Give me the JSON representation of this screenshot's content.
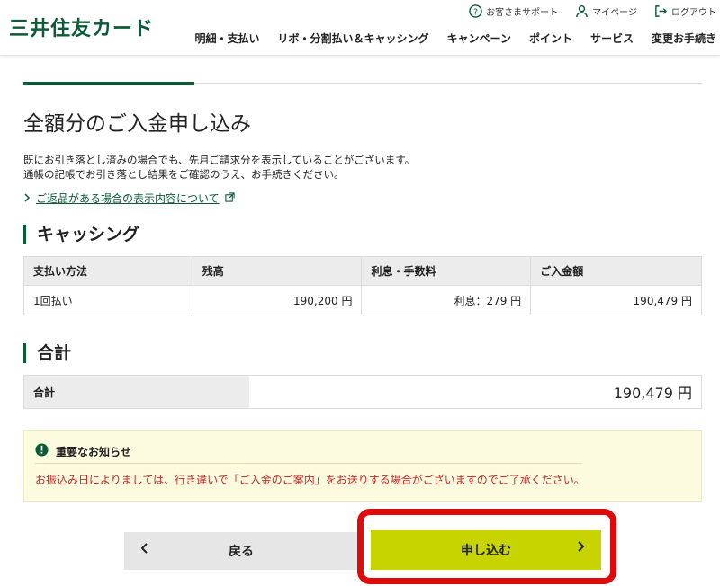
{
  "header": {
    "logo": "三井住友カード",
    "util": [
      {
        "label": "お客さまサポート",
        "icon": "help-circle-icon"
      },
      {
        "label": "マイページ",
        "icon": "user-icon"
      },
      {
        "label": "ログアウト",
        "icon": "logout-icon"
      }
    ],
    "nav": [
      "明細・支払い",
      "リボ・分割払い＆キャッシング",
      "キャンペーン",
      "ポイント",
      "サービス",
      "変更お手続き"
    ]
  },
  "page": {
    "title": "全額分のご入金申し込み",
    "intro_line1": "既にお引き落とし済みの場合でも、先月ご請求分を表示していることがございます。",
    "intro_line2": "通帳の記帳でお引き落とし結果をご確認のうえ、お手続きください。",
    "link": "ご返品がある場合の表示内容について"
  },
  "cashing": {
    "section_title": "キャッシング",
    "headers": [
      "支払い方法",
      "残高",
      "利息・手数料",
      "ご入金額"
    ],
    "rows": [
      [
        "1回払い",
        "190,200 円",
        "利息：279 円",
        "190,479 円"
      ]
    ]
  },
  "total": {
    "section_title": "合計",
    "label": "合計",
    "value": "190,479 円"
  },
  "notice": {
    "title": "重要なお知らせ",
    "text": "お振込み日によりましては、行き違いで「ご入金のご案内」をお送りする場合がございますのでご了承ください。"
  },
  "buttons": {
    "back": "戻る",
    "apply": "申し込む"
  },
  "colors": {
    "brand": "#0b5b36",
    "apply_button": "#c8d400",
    "highlight": "#e10a0a",
    "notice_text": "#c62828"
  }
}
